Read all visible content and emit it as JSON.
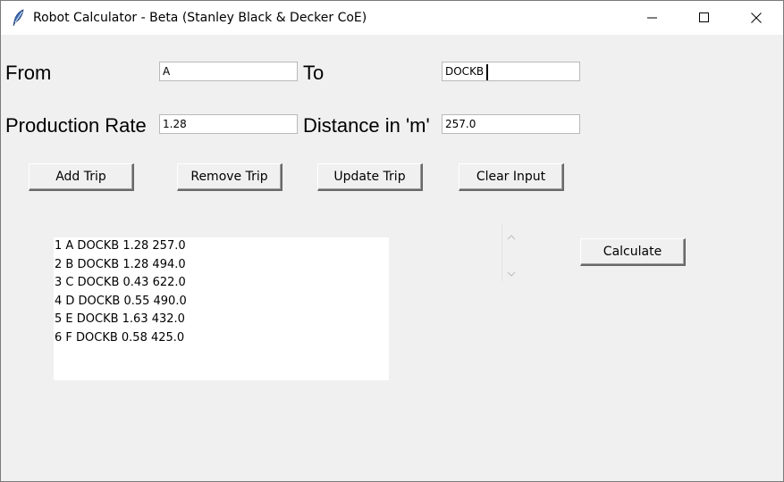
{
  "window": {
    "title": "Robot Calculator - Beta (Stanley Black & Decker CoE)",
    "app_icon": "feather-icon",
    "controls": [
      "minimize-icon",
      "maximize-icon",
      "close-icon"
    ]
  },
  "form": {
    "from_label": "From",
    "from_value": "A",
    "to_label": "To",
    "to_value": "DOCKB",
    "rate_label": "Production Rate",
    "rate_value": "1.28",
    "distance_label": "Distance in 'm'",
    "distance_value": "257.0"
  },
  "buttons": {
    "add_trip": "Add Trip",
    "remove_trip": "Remove Trip",
    "update_trip": "Update Trip",
    "clear_input": "Clear Input",
    "calculate": "Calculate"
  },
  "trips": [
    "1 A DOCKB 1.28 257.0",
    "2 B DOCKB 1.28 494.0",
    "3 C DOCKB 0.43 622.0",
    "4 D DOCKB 0.55 490.0",
    "5 E DOCKB 1.63 432.0",
    "6 F DOCKB 0.58 425.0"
  ]
}
